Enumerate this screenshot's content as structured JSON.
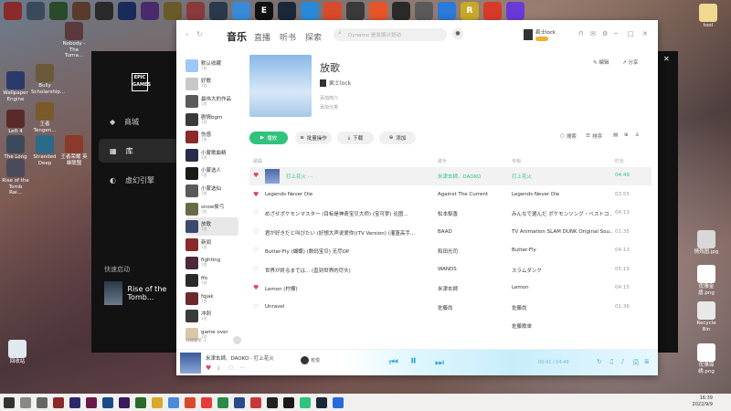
{
  "desktop": {
    "left_icons": [
      {
        "label": "The Long Dark",
        "color": "#3a4a5a"
      },
      {
        "label": "Stranded Deep",
        "color": "#2a6a8a"
      },
      {
        "label": "王者荣耀 英雄联盟",
        "color": "#8a3a2a"
      },
      {
        "label": "Rise of the Tomb Rai...",
        "color": "#4a4a5a"
      },
      {
        "label": "Wallpaper Engine",
        "color": "#2a3a6a"
      },
      {
        "label": "Bully Scholarship...",
        "color": "#6a5a3a"
      },
      {
        "label": "Nobody - The Turna...",
        "color": "#5a3a3a"
      },
      {
        "label": "Left 4 Dead",
        "color": "#5a2a2a"
      },
      {
        "label": "王者 Tengen...",
        "color": "#7a5a2a"
      }
    ],
    "right_icons": [
      {
        "label": "tool",
        "color": "#f0f0f0"
      },
      {
        "label": "情殇图.jpg",
        "color": "#d8d8d8"
      },
      {
        "label": "优雅金盾.png",
        "color": "#ffffff"
      },
      {
        "label": "Recycle Bin",
        "color": "#e8e8e8"
      },
      {
        "label": "优雅锦绣.png",
        "color": "#ffffff"
      }
    ],
    "recycle_bin": "回收站"
  },
  "epic": {
    "logo": "EPIC GAMES",
    "nav": [
      "商城",
      "库",
      "虚幻引擎"
    ],
    "active_nav": 1,
    "quick_launch": "快速启动",
    "game": "Rise of the Tomb..."
  },
  "app": {
    "tabs": {
      "music": "音乐",
      "live": "直播",
      "books": "听书",
      "explore": "探索"
    },
    "search_placeholder": "Dynamo 是发展计划动",
    "user": "疯士lock",
    "sidebar": [
      {
        "name": "默认收藏",
        "count": "1首",
        "color": "#9ec8f8"
      },
      {
        "name": "好歌",
        "count": "1首",
        "color": "#c8c8c8"
      },
      {
        "name": "最伟大的作品",
        "count": "1首",
        "color": "#5a5a5a"
      },
      {
        "name": "剧情bgm",
        "count": "1首",
        "color": "#3a3a3a"
      },
      {
        "name": "伤感",
        "count": "1首",
        "color": "#8a2a2a"
      },
      {
        "name": "小蒙歌曲精",
        "count": "1首",
        "color": "#2a2a4a"
      },
      {
        "name": "小蒙选人",
        "count": "1首",
        "color": "#1a1a1a"
      },
      {
        "name": "小蒙选仙",
        "count": "1首",
        "color": "#5a5a5a"
      },
      {
        "name": "snow俊弓",
        "count": "1首",
        "color": "#6a6a4a"
      },
      {
        "name": "放歌",
        "count": "1首",
        "color": "#3a4a6a"
      },
      {
        "name": "新闻",
        "count": "1首",
        "color": "#8a2a2a"
      },
      {
        "name": "fighting",
        "count": "1首",
        "color": "#4a2a3a"
      },
      {
        "name": "ffo",
        "count": "1首",
        "color": "#2a2a2a"
      },
      {
        "name": "fqjak",
        "count": "1首",
        "color": "#6a2a2a"
      },
      {
        "name": "冲刺",
        "count": "1首",
        "color": "#3a3a3a"
      },
      {
        "name": "game over",
        "count": "1首",
        "color": "#d8c8a8"
      }
    ],
    "selected_playlist": 9,
    "sidebar_footer": "创建歌单 +",
    "playlist": {
      "title": "放歌",
      "creator": "疯士lock",
      "meta1": "添加简介",
      "meta2": "添加分类",
      "edit": "编辑",
      "share": "分享"
    },
    "buttons": {
      "play": "播放",
      "batch": "批量操作",
      "download": "下载",
      "add": "添加"
    },
    "tools": {
      "search": "搜索",
      "sort": "排序"
    },
    "columns": {
      "title": "歌曲",
      "artist": "歌手",
      "album": "专辑",
      "duration": "时长"
    },
    "songs": [
      {
        "title": "打上花火 ⋯",
        "artist": "米津玄師、DAOKO",
        "album": "打上花火",
        "duration": "04:49",
        "liked": true,
        "current": true
      },
      {
        "title": "Legends Never Die",
        "artist": "Against The Current",
        "album": "Legends Never Die",
        "duration": "03:55",
        "liked": true
      },
      {
        "title": "めざせポケモンマスター (目标是神奇宝贝大师) (宝可梦) 论图...",
        "artist": "松本梨香",
        "album": "みんなで選んだ ポケモンソング・ベストコ...",
        "duration": "04:13",
        "liked": false
      },
      {
        "title": "君が好きだと叫びたい (好想大声说爱你)(TV Version) (灌篮高手...",
        "artist": "BAAD",
        "album": "TV Animation SLAM DUNK Original Sou...",
        "duration": "01:35",
        "liked": false
      },
      {
        "title": "Butter-Fly (蝴蝶) (数码宝贝) 无尽OP",
        "artist": "和田光司",
        "album": "Butter-Fly",
        "duration": "04:13",
        "liked": false
      },
      {
        "title": "世界が終るまでは... (直到世界的尽头)",
        "artist": "WANDS",
        "album": "スラムダンク",
        "duration": "05:19",
        "liked": false
      },
      {
        "title": "Lemon (柠檬)",
        "artist": "米津玄師",
        "album": "Lemon",
        "duration": "04:15",
        "liked": true
      },
      {
        "title": "Unravel",
        "artist": "佐藤尚",
        "album": "佐藤尚",
        "duration": "01:36",
        "liked": false
      },
      {
        "title": "",
        "artist": "",
        "album": "佐藤歌单",
        "duration": "",
        "liked": false
      }
    ],
    "player": {
      "now_playing": "米津玄師、DAOKO - 打上花火",
      "time": "00:41 / 04:49",
      "extra": "有悦"
    }
  },
  "tray": {
    "time": "16:39",
    "date": "2022/9/9"
  }
}
